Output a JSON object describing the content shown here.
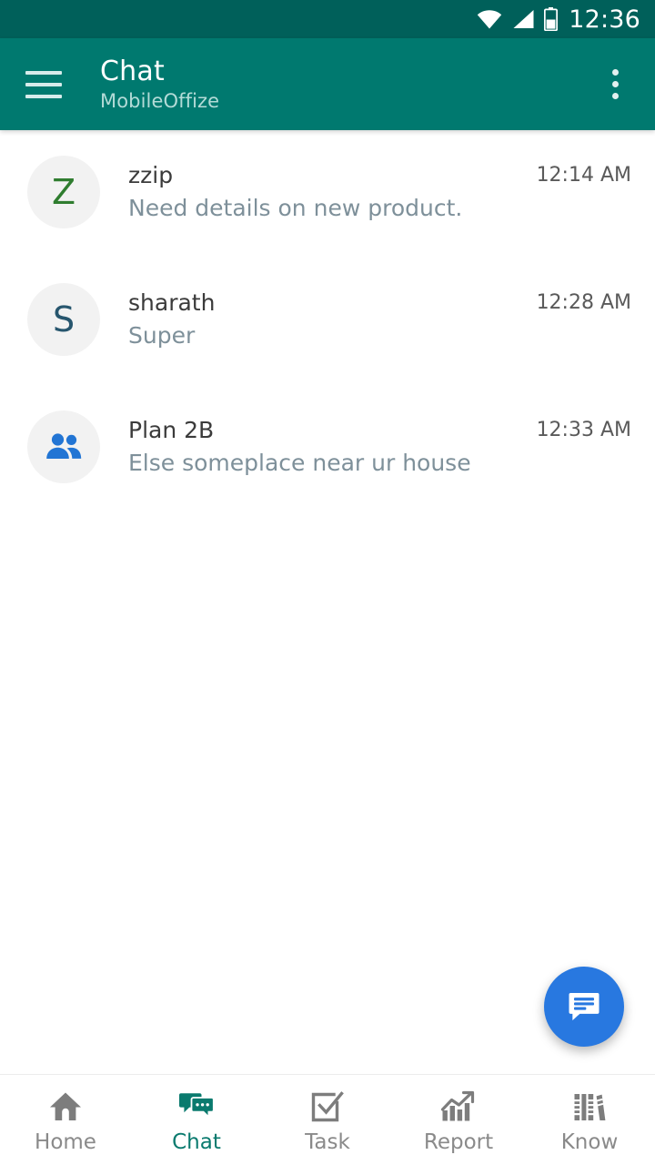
{
  "status_bar": {
    "time": "12:36",
    "icons": [
      "wifi-icon",
      "cell-signal-icon",
      "battery-icon"
    ],
    "background_color": "#00605a",
    "battery_level_percent": 45
  },
  "app_bar": {
    "menu_icon": "hamburger-menu-icon",
    "title": "Chat",
    "subtitle": "MobileOffize",
    "overflow_icon": "more-vertical-icon",
    "background_color": "#00796f"
  },
  "chat_list": [
    {
      "avatar_type": "letter",
      "avatar_letter": "Z",
      "avatar_color": "#2f7d2f",
      "name": "zzip",
      "preview": "Need details on new product.",
      "time": "12:14 AM"
    },
    {
      "avatar_type": "letter",
      "avatar_letter": "S",
      "avatar_color": "#27566e",
      "name": "sharath",
      "preview": "Super",
      "time": "12:28 AM"
    },
    {
      "avatar_type": "group",
      "avatar_icon": "people-group-icon",
      "avatar_color": "#2275d4",
      "name": "Plan 2B",
      "preview": "Else someplace near ur house",
      "time": "12:33 AM"
    }
  ],
  "fab": {
    "icon": "new-message-icon",
    "background_color": "#2878e0"
  },
  "bottom_nav": {
    "active_color": "#0a7a6e",
    "inactive_color": "#8a8a8a",
    "items": [
      {
        "label": "Home",
        "icon": "home-icon",
        "active": false
      },
      {
        "label": "Chat",
        "icon": "chat-bubbles-icon",
        "active": true
      },
      {
        "label": "Task",
        "icon": "task-check-icon",
        "active": false
      },
      {
        "label": "Report",
        "icon": "chart-trend-icon",
        "active": false
      },
      {
        "label": "Know",
        "icon": "books-icon",
        "active": false
      }
    ]
  }
}
